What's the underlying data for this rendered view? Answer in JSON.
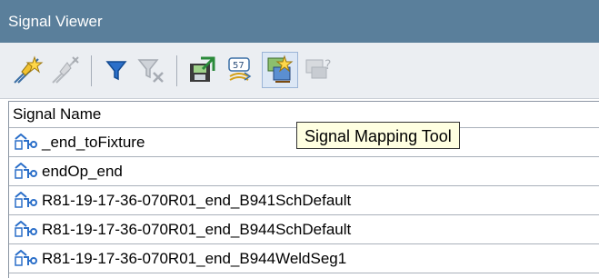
{
  "window": {
    "title": "Signal Viewer"
  },
  "toolbar": {
    "buttons": [
      {
        "name": "create-signal-icon",
        "enabled": true
      },
      {
        "name": "remove-signal-icon",
        "enabled": false
      },
      {
        "name": "filter-icon",
        "enabled": true
      },
      {
        "name": "clear-filter-icon",
        "enabled": false
      },
      {
        "name": "export-icon",
        "enabled": true
      },
      {
        "name": "numeric-icon",
        "enabled": true
      },
      {
        "name": "signal-mapping-icon",
        "enabled": true,
        "hovered": true
      },
      {
        "name": "signal-mapping-disabled-icon",
        "enabled": false
      }
    ]
  },
  "tooltip": {
    "text": "Signal Mapping Tool"
  },
  "table": {
    "columns": [
      "Signal Name"
    ],
    "rows": [
      "_end_toFixture",
      "endOp_end",
      "R81-19-17-36-070R01_end_B941SchDefault",
      "R81-19-17-36-070R01_end_B944SchDefault",
      "R81-19-17-36-070R01_end_B944WeldSeg1"
    ]
  },
  "colors": {
    "titlebar": "#5a7f9b",
    "toolbar": "#ebeef2",
    "tooltip_bg": "#ffffe1"
  }
}
